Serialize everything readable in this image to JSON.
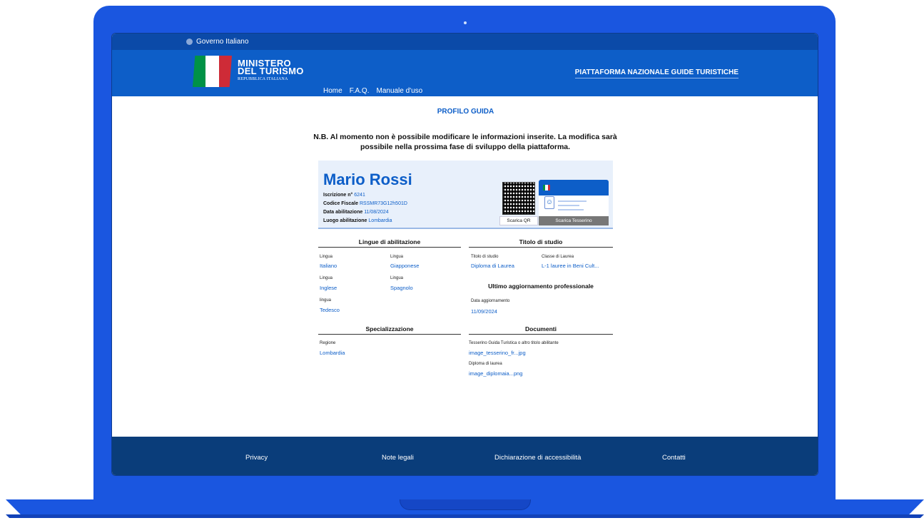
{
  "gov_bar": {
    "label": "Governo Italiano"
  },
  "header": {
    "brand_line1": "MINISTERO",
    "brand_line2": "DEL TURISMO",
    "brand_line3": "REPUBBLICA ITALIANA",
    "platform": "PIATTAFORMA NAZIONALE GUIDE TURISTICHE",
    "nav": [
      "Home",
      "F.A.Q.",
      "Manuale d'uso"
    ]
  },
  "page": {
    "title": "PROFILO GUIDA",
    "notice_line1": "N.B. Al momento non è possibile modificare le informazioni inserite. La modifica sarà",
    "notice_line2": "possibile nella prossima fase di sviluppo della piattaforma."
  },
  "profile": {
    "name": "Mario Rossi",
    "fields": [
      {
        "label": "Iscrizione n°",
        "value": "6241"
      },
      {
        "label": "Codice Fiscale",
        "value": "RSSMR73G12h501D"
      },
      {
        "label": "Data abilitazione",
        "value": "11/08/2024"
      },
      {
        "label": "Luogo abilitazione",
        "value": "Lombardia"
      }
    ],
    "qr_button": "Scarica QR",
    "card_button": "Scarica Tesserino"
  },
  "lingue": {
    "title": "Lingue di abilitazione",
    "items": [
      {
        "label": "Lingua",
        "value": "Italiano"
      },
      {
        "label": "Lingua",
        "value": "Giapponese"
      },
      {
        "label": "Lingua",
        "value": "Inglese"
      },
      {
        "label": "Lingua",
        "value": "Spagnolo"
      },
      {
        "label": "lingua",
        "value": "Tedesco"
      }
    ]
  },
  "titolo": {
    "title": "Titolo di studio",
    "items": [
      {
        "label": "Titolo di studio",
        "value": "Diploma di Laurea"
      },
      {
        "label": "Classe di Laurea",
        "value": "L-1 lauree in Beni Cult..."
      }
    ]
  },
  "aggiornamento": {
    "title": "Ultimo aggiornamento professionale",
    "label": "Data aggiornamento",
    "value": "11/09/2024"
  },
  "specializzazione": {
    "title": "Specializzazione",
    "label": "Regione",
    "value": "Lombardia"
  },
  "documenti": {
    "title": "Documenti",
    "items": [
      {
        "label": "Tesserino Guida Turistica o altro titolo abilitante",
        "value": "image_tesserino_fr...jpg"
      },
      {
        "label": "Diploma di laurea",
        "value": "image_diplomaia...png"
      }
    ]
  },
  "footer": [
    "Privacy",
    "Note legali",
    "Dichiarazione di accessibilità",
    "Contatti"
  ],
  "colors": {
    "brand_blue": "#0d5ec8",
    "device_blue": "#1a56e0",
    "footer": "#0a3d7a",
    "flag_green": "#009246",
    "flag_red": "#ce2b37"
  }
}
